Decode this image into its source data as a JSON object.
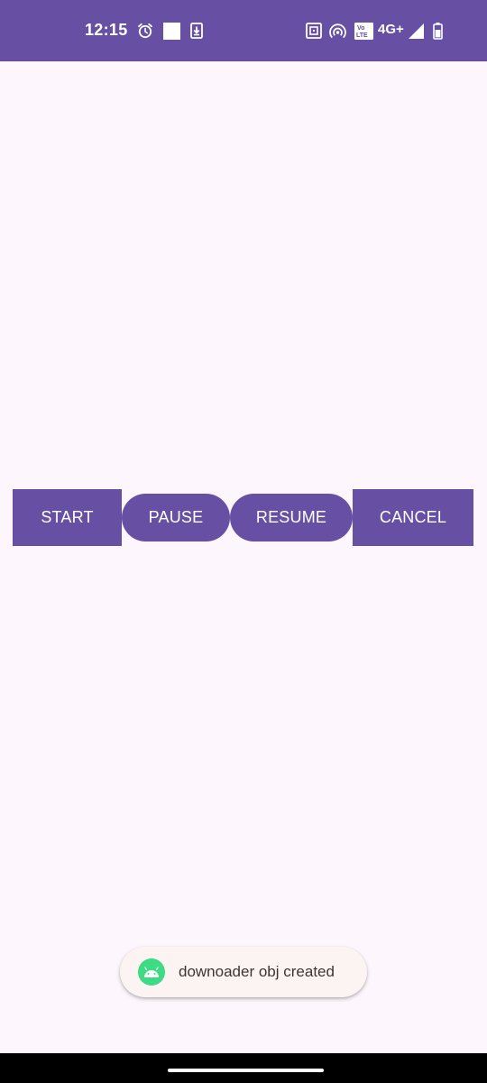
{
  "status_bar": {
    "time": "12:15",
    "network": "4G+",
    "volte": "Vo LTE",
    "background_color": "#6750A4",
    "icons_left": [
      "alarm-icon",
      "white-square-notification-icon",
      "download-notification-icon"
    ],
    "icons_right": [
      "nfc-icon",
      "hotspot-icon",
      "volte-icon",
      "signal-icon",
      "battery-icon"
    ]
  },
  "buttons": {
    "start": "START",
    "pause": "PAUSE",
    "resume": "RESUME",
    "cancel": "CANCEL",
    "color": "#6750A4"
  },
  "toast": {
    "text": "downoader obj created",
    "icon": "android-icon"
  },
  "colors": {
    "background": "#FDF7FD",
    "primary": "#6750A4",
    "android_green": "#3DDC84"
  }
}
